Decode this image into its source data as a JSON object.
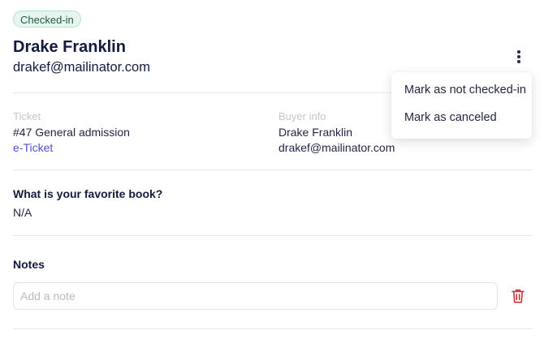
{
  "status_badge": "Checked-in",
  "attendee": {
    "name": "Drake Franklin",
    "email": "drakef@mailinator.com"
  },
  "ticket": {
    "label": "Ticket",
    "value": "#47 General admission",
    "link": "e-Ticket"
  },
  "buyer": {
    "label": "Buyer info",
    "name": "Drake Franklin",
    "email": "drakef@mailinator.com"
  },
  "question": {
    "text": "What is your favorite book?",
    "answer": "N/A"
  },
  "notes": {
    "label": "Notes",
    "placeholder": "Add a note"
  },
  "menu": {
    "items": [
      "Mark as not checked-in",
      "Mark as canceled"
    ]
  },
  "icons": {
    "more": "more-vertical-icon",
    "delete": "trash-icon"
  },
  "colors": {
    "accent": "#4f52d1",
    "badge_bg": "#e6f6ee",
    "danger": "#d32f3a"
  }
}
